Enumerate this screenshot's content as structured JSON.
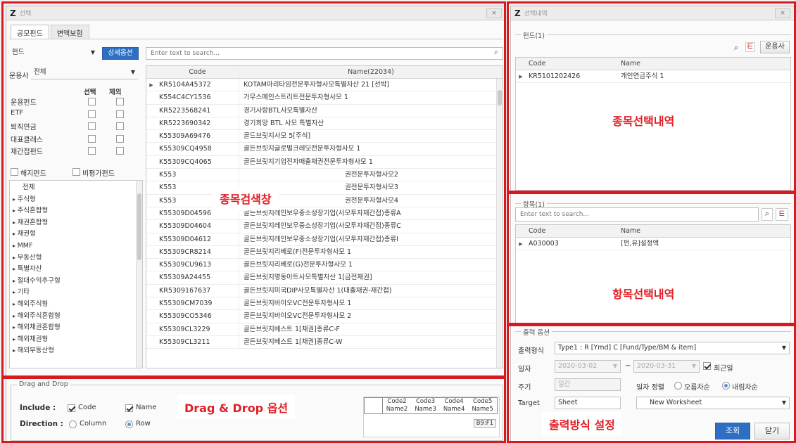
{
  "left_window": {
    "title": "선택",
    "close": "×",
    "tabs": [
      "공모펀드",
      "변액보험"
    ],
    "fund_dropdown": "펀드",
    "detail_button": "상세옵션",
    "search_placeholder": "Enter text to search...",
    "company_label": "운용사",
    "company_value": "전체",
    "col_select": "선택",
    "col_exclude": "제외",
    "filters": [
      "운용펀드",
      "ETF",
      "퇴직연금",
      "대표클래스",
      "재간접펀드"
    ],
    "overseas_fund": "해지펀드",
    "nonval_fund": "비평가펀드",
    "tree": [
      "전체",
      "주식형",
      "주식혼합형",
      "채권혼합형",
      "채권형",
      "MMF",
      "부동산형",
      "특별자산",
      "절대수익추구형",
      "기타",
      "해외주식형",
      "해외주식혼합형",
      "해외채권혼합형",
      "해외채권형",
      "해외부동산형"
    ],
    "grid_head": {
      "code": "Code",
      "name": "Name(22034)"
    },
    "rows": [
      {
        "code": "KR5104A45372",
        "name": "KOTAM마리타임전문투자형사모특별자산 21 [선박]"
      },
      {
        "code": "K554C4CY1536",
        "name": "가우스메인스트리트전문투자형사모 1"
      },
      {
        "code": "KR5223568241",
        "name": "경기사랑BTL사모특별자산"
      },
      {
        "code": "KR5223690342",
        "name": "경기희망 BTL 사모 특별자산"
      },
      {
        "code": "K55309A69476",
        "name": "골드브릿지사모 5[주식]"
      },
      {
        "code": "K55309CQ4958",
        "name": "골든브릿지글로벌크레딧전문투자형사모 1"
      },
      {
        "code": "K55309CQ4065",
        "name": "골든브릿지기업전자매출채권전문투자형사모 1"
      },
      {
        "code": "K553",
        "name": "권전문투자형사모2"
      },
      {
        "code": "K553",
        "name": "권전문투자형사모3"
      },
      {
        "code": "K553",
        "name": "권전문투자형사모4"
      },
      {
        "code": "K55309D04596",
        "name": "골든브릿지레인보우중소성장기업(사모투자재간접)종류A"
      },
      {
        "code": "K55309D04604",
        "name": "골든브릿지레인보우중소성장기업(사모투자재간접)종류C"
      },
      {
        "code": "K55309D04612",
        "name": "골든브릿지레인보우중소성장기업(사모투자재간접)종류I"
      },
      {
        "code": "K55309CR8214",
        "name": "골든브릿지리베로(F)전문투자형사모 1"
      },
      {
        "code": "K55309CU9613",
        "name": "골든브릿지리베로(G)전문투자형사모 1"
      },
      {
        "code": "K55309A24455",
        "name": "골든브릿지명동아트사모특별자산 1[금전채권]"
      },
      {
        "code": "KR5309167637",
        "name": "골든브릿지미국DIP사모특별자산 1(대출채권-재간접)"
      },
      {
        "code": "K55309CM7039",
        "name": "골든브릿지바이오VC전문투자형사모 1"
      },
      {
        "code": "K55309CO5346",
        "name": "골든브릿지바이오VC전문투자형사모 2"
      },
      {
        "code": "K55309CL3229",
        "name": "골든브릿지베스트 1[채권]종류C-F"
      },
      {
        "code": "K55309CL3211",
        "name": "골든브릿지베스트 1[채권]종류C-W"
      }
    ],
    "dnd": {
      "legend": "Drag and Drop",
      "include": "Include :",
      "code": "Code",
      "name": "Name",
      "direction": "Direction :",
      "column": "Column",
      "row": "Row",
      "preview_codes": [
        "Code2",
        "Code3",
        "Code4",
        "Code5"
      ],
      "preview_names": [
        "Name2",
        "Name3",
        "Name4",
        "Name5"
      ],
      "cell_ref": "B9:F1"
    }
  },
  "right_window": {
    "title": "선택내역",
    "close": "×",
    "fund_legend": "펀드(1)",
    "company_btn": "운용사",
    "fund_head": {
      "code": "Code",
      "name": "Name"
    },
    "fund_rows": [
      {
        "code": "KR5101202426",
        "name": "개인연금주식 1"
      }
    ],
    "item_legend": "항목(1)",
    "item_placeholder": "Enter text to search...",
    "item_head": {
      "code": "Code",
      "name": "Name"
    },
    "item_rows": [
      {
        "code": "A030003",
        "name": "[펀,유]설정액"
      }
    ],
    "output": {
      "legend": "출력 옵션",
      "format_label": "출력형식",
      "format_value": "Type1 : R [Ymd] C [Fund/Type/BM & item]",
      "date_label": "일자",
      "date_from": "2020-03-02",
      "date_to": "2020-03-31",
      "dash": "~",
      "recent": "최근일",
      "period_label": "주기",
      "period_value": "일간",
      "sort_label": "일자 정렬",
      "asc": "오름차순",
      "desc": "내림차순",
      "target_label": "Target",
      "target_value": "Sheet",
      "target_sheet": "New Worksheet",
      "query": "조회",
      "close": "닫기"
    }
  },
  "annotations": {
    "search": "종목검색창",
    "selected_items": "종목선택내역",
    "selected_fields": "항목선택내역",
    "dnd_option": "Drag & Drop 옵션",
    "output_setting": "출력방식 설정"
  }
}
